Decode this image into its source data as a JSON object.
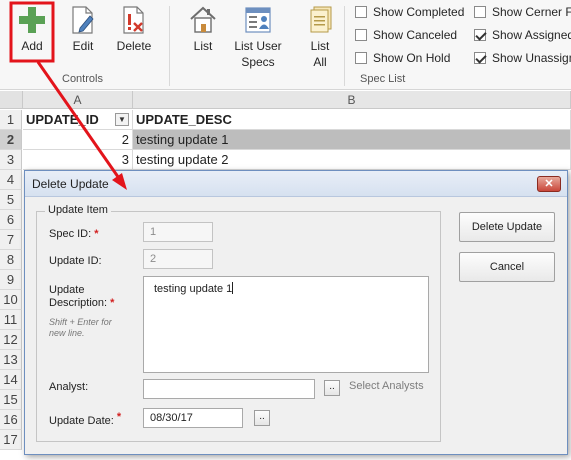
{
  "ribbon": {
    "controls": {
      "add_label": "Add",
      "edit_label": "Edit",
      "delete_label": "Delete",
      "group_label": "Controls"
    },
    "spec_list": {
      "list_label": "List",
      "list_user_specs_label_line1": "List User",
      "list_user_specs_label_line2": "Specs",
      "list_all_label_line1": "List",
      "list_all_label_line2": "All",
      "group_label": "Spec List"
    },
    "checkboxes": [
      {
        "label": "Show Completed",
        "checked": false
      },
      {
        "label": "Show Canceled",
        "checked": false
      },
      {
        "label": "Show On Hold",
        "checked": false
      },
      {
        "label": "Show Cerner Fix",
        "checked": false
      },
      {
        "label": "Show Assigned",
        "checked": true
      },
      {
        "label": "Show Unassign",
        "checked": true
      }
    ]
  },
  "sheet": {
    "columns": [
      "A",
      "B"
    ],
    "row_numbers": [
      "1",
      "2",
      "3",
      "4",
      "5",
      "6",
      "7",
      "8",
      "9",
      "10",
      "11",
      "12",
      "13",
      "14",
      "15",
      "16",
      "17"
    ],
    "header_row": {
      "a": "UPDATE_ID",
      "b": "UPDATE_DESC"
    },
    "rows": [
      {
        "id": "2",
        "desc": "testing update 1",
        "selected": true
      },
      {
        "id": "3",
        "desc": "testing update 2",
        "selected": false
      }
    ]
  },
  "dialog": {
    "title": "Delete Update",
    "close_glyph": "✕",
    "frame_title": "Update Item",
    "spec_id_label": "Spec ID:",
    "spec_id_value": "1",
    "update_id_label": "Update ID:",
    "update_id_value": "2",
    "desc_label_line1": "Update",
    "desc_label_line2": "Description:",
    "desc_hint_line1": "Shift + Enter for",
    "desc_hint_line2": "new line.",
    "desc_value": "testing update 1",
    "analyst_label": "Analyst:",
    "analyst_value": "",
    "analyst_btn": "..",
    "select_analysts_label": "Select Analysts",
    "update_date_label": "Update Date:",
    "update_date_value": "08/30/17",
    "date_btn": "..",
    "required_mark": "*",
    "delete_button": "Delete Update",
    "cancel_button": "Cancel"
  },
  "colors": {
    "annotation_red": "#e3141b",
    "add_green": "#5aa155",
    "selected_row": "#bdbdbd"
  }
}
